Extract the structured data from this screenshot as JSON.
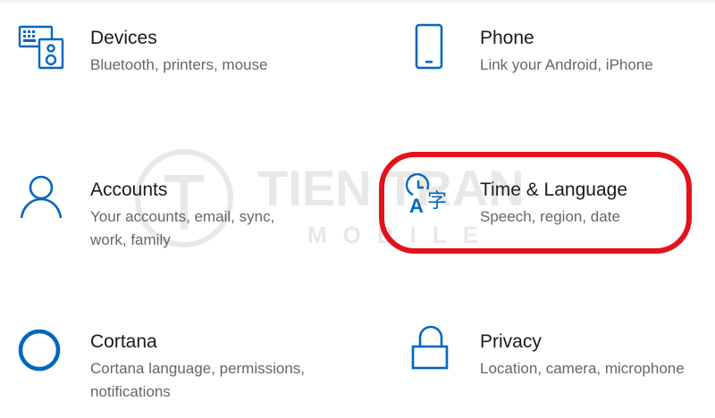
{
  "settings": {
    "items": [
      {
        "title": "Devices",
        "desc": "Bluetooth, printers, mouse",
        "icon": "devices-icon"
      },
      {
        "title": "Phone",
        "desc": "Link your Android, iPhone",
        "icon": "phone-icon"
      },
      {
        "title": "Accounts",
        "desc": "Your accounts, email, sync, work, family",
        "icon": "person-icon"
      },
      {
        "title": "Time & Language",
        "desc": "Speech, region, date",
        "icon": "time-language-icon"
      },
      {
        "title": "Cortana",
        "desc": "Cortana language, permissions, notifications",
        "icon": "cortana-icon"
      },
      {
        "title": "Privacy",
        "desc": "Location, camera, microphone",
        "icon": "lock-icon"
      }
    ]
  },
  "watermark": {
    "line1": "TIEN TRAN",
    "line2": "MOBILE"
  },
  "colors": {
    "accent": "#0067c0",
    "highlight": "#e3121b"
  }
}
